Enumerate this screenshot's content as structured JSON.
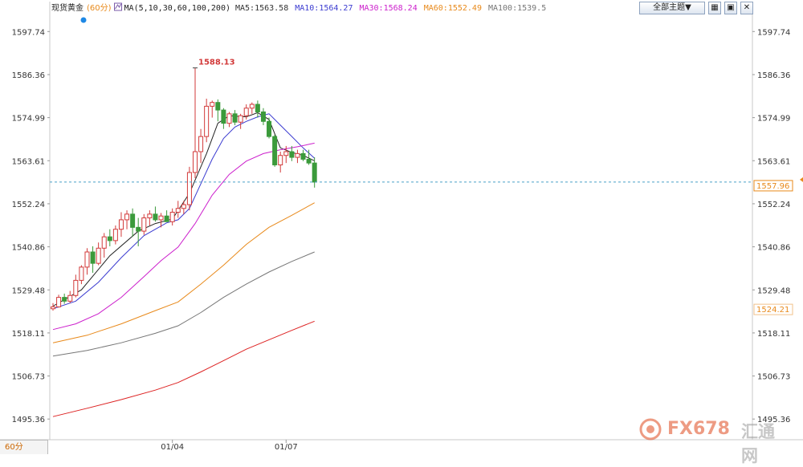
{
  "header": {
    "instrument": "现货黄金",
    "timeframe": "(60分)",
    "ma_label": "MA(5,10,30,60,100,200)",
    "ma_values": [
      {
        "text": "MA5:1563.58",
        "color": "#333333"
      },
      {
        "text": "MA10:1564.27",
        "color": "#3b3bd0"
      },
      {
        "text": "MA30:1568.24",
        "color": "#cc1fcc"
      },
      {
        "text": "MA60:1552.49",
        "color": "#e8891a"
      },
      {
        "text": "MA100:1539.5",
        "color": "#777777"
      }
    ]
  },
  "toolbar": {
    "theme_label": "全部主题▼"
  },
  "footer": {
    "timeframe_tab": "60分"
  },
  "watermark": {
    "text": "FX678",
    "cn": "汇通网"
  },
  "chart_data": {
    "type": "candlestick",
    "yticks": [
      "1597.74",
      "1586.36",
      "1574.99",
      "1563.61",
      "1552.24",
      "1540.86",
      "1529.48",
      "1518.11",
      "1506.73",
      "1495.36"
    ],
    "ylim": [
      1490,
      1600
    ],
    "xticks": [
      {
        "label": "01/04",
        "index": 21
      },
      {
        "label": "01/07",
        "index": 41
      }
    ],
    "last_price": "1557.96",
    "right_label": "1524.21",
    "high_annotation": {
      "text": "1588.13",
      "index": 25
    },
    "candles": [
      [
        1524.5,
        1526.0,
        1524.0,
        1525.0
      ],
      [
        1525.0,
        1528.2,
        1524.8,
        1527.5
      ],
      [
        1527.5,
        1528.5,
        1525.8,
        1526.5
      ],
      [
        1526.5,
        1529.2,
        1526.0,
        1528.0
      ],
      [
        1528.0,
        1533.5,
        1527.5,
        1532.0
      ],
      [
        1532.0,
        1536.0,
        1531.0,
        1535.5
      ],
      [
        1535.5,
        1540.5,
        1533.5,
        1539.5
      ],
      [
        1539.5,
        1541.0,
        1534.0,
        1536.5
      ],
      [
        1536.5,
        1542.0,
        1536.0,
        1540.5
      ],
      [
        1540.5,
        1544.5,
        1538.0,
        1543.5
      ],
      [
        1543.5,
        1545.5,
        1541.0,
        1542.5
      ],
      [
        1542.5,
        1546.5,
        1541.5,
        1545.5
      ],
      [
        1545.5,
        1550.0,
        1543.5,
        1548.0
      ],
      [
        1548.0,
        1550.5,
        1545.5,
        1549.5
      ],
      [
        1549.5,
        1551.0,
        1543.5,
        1546.0
      ],
      [
        1546.0,
        1548.5,
        1541.0,
        1545.0
      ],
      [
        1545.0,
        1549.5,
        1544.0,
        1548.5
      ],
      [
        1548.5,
        1550.5,
        1546.5,
        1549.5
      ],
      [
        1549.5,
        1551.5,
        1547.5,
        1548.0
      ],
      [
        1548.0,
        1549.8,
        1546.0,
        1549.0
      ],
      [
        1549.0,
        1550.5,
        1547.5,
        1547.5
      ],
      [
        1547.5,
        1551.0,
        1546.5,
        1550.0
      ],
      [
        1550.0,
        1553.0,
        1548.5,
        1551.0
      ],
      [
        1551.0,
        1553.0,
        1549.5,
        1552.0
      ],
      [
        1552.0,
        1562.0,
        1550.5,
        1560.5
      ],
      [
        1560.5,
        1588.13,
        1559.0,
        1566.0
      ],
      [
        1566.0,
        1572.0,
        1563.0,
        1570.0
      ],
      [
        1570.0,
        1580.0,
        1568.5,
        1578.0
      ],
      [
        1578.0,
        1579.5,
        1575.0,
        1579.0
      ],
      [
        1579.0,
        1579.8,
        1574.0,
        1577.0
      ],
      [
        1577.0,
        1577.5,
        1572.0,
        1573.5
      ],
      [
        1573.5,
        1576.5,
        1572.5,
        1576.0
      ],
      [
        1576.0,
        1577.0,
        1573.0,
        1573.8
      ],
      [
        1573.8,
        1576.0,
        1572.0,
        1575.5
      ],
      [
        1575.5,
        1578.5,
        1574.5,
        1577.5
      ],
      [
        1577.5,
        1579.0,
        1576.0,
        1578.5
      ],
      [
        1578.5,
        1579.5,
        1575.0,
        1576.5
      ],
      [
        1576.5,
        1577.5,
        1573.0,
        1574.0
      ],
      [
        1574.0,
        1575.0,
        1569.5,
        1570.0
      ],
      [
        1570.0,
        1570.5,
        1562.0,
        1562.5
      ],
      [
        1562.5,
        1566.0,
        1560.5,
        1565.0
      ],
      [
        1565.0,
        1567.5,
        1563.0,
        1566.0
      ],
      [
        1566.0,
        1567.5,
        1563.5,
        1564.5
      ],
      [
        1564.5,
        1566.5,
        1563.0,
        1565.5
      ],
      [
        1565.5,
        1566.5,
        1563.5,
        1564.0
      ],
      [
        1564.0,
        1566.5,
        1562.5,
        1563.0
      ],
      [
        1563.0,
        1564.5,
        1556.5,
        1557.96
      ]
    ],
    "series": [
      {
        "name": "MA5",
        "color": "#222222",
        "values": [
          [
            0,
            1525.2
          ],
          [
            5,
            1529.5
          ],
          [
            10,
            1538.5
          ],
          [
            15,
            1545.0
          ],
          [
            18,
            1547.0
          ],
          [
            21,
            1548.2
          ],
          [
            24,
            1555.0
          ],
          [
            27,
            1565.5
          ],
          [
            29,
            1573.5
          ],
          [
            31,
            1575.5
          ],
          [
            34,
            1575.2
          ],
          [
            36,
            1576.3
          ],
          [
            38,
            1574.5
          ],
          [
            40,
            1567.0
          ],
          [
            42,
            1565.8
          ],
          [
            44,
            1565.0
          ],
          [
            46,
            1563.58
          ]
        ]
      },
      {
        "name": "MA10",
        "color": "#3b3bd0",
        "values": [
          [
            0,
            1524.5
          ],
          [
            4,
            1526.5
          ],
          [
            8,
            1531.5
          ],
          [
            12,
            1538.0
          ],
          [
            16,
            1543.8
          ],
          [
            20,
            1547.2
          ],
          [
            22,
            1548.0
          ],
          [
            24,
            1551.0
          ],
          [
            26,
            1557.5
          ],
          [
            28,
            1564.0
          ],
          [
            30,
            1569.5
          ],
          [
            32,
            1572.5
          ],
          [
            34,
            1574.0
          ],
          [
            36,
            1575.2
          ],
          [
            38,
            1576.0
          ],
          [
            40,
            1573.0
          ],
          [
            42,
            1570.0
          ],
          [
            44,
            1567.0
          ],
          [
            46,
            1564.27
          ]
        ]
      },
      {
        "name": "MA30",
        "color": "#cc1fcc",
        "values": [
          [
            0,
            1519.0
          ],
          [
            4,
            1520.5
          ],
          [
            8,
            1523.2
          ],
          [
            12,
            1527.5
          ],
          [
            16,
            1533.0
          ],
          [
            19,
            1537.2
          ],
          [
            22,
            1540.8
          ],
          [
            25,
            1547.0
          ],
          [
            28,
            1554.5
          ],
          [
            31,
            1560.0
          ],
          [
            34,
            1563.5
          ],
          [
            37,
            1565.5
          ],
          [
            40,
            1566.5
          ],
          [
            43,
            1567.3
          ],
          [
            46,
            1568.24
          ]
        ]
      },
      {
        "name": "MA60",
        "color": "#e8891a",
        "values": [
          [
            0,
            1515.5
          ],
          [
            6,
            1517.5
          ],
          [
            12,
            1520.5
          ],
          [
            18,
            1524.0
          ],
          [
            22,
            1526.3
          ],
          [
            26,
            1531.0
          ],
          [
            30,
            1536.0
          ],
          [
            34,
            1541.5
          ],
          [
            38,
            1546.0
          ],
          [
            42,
            1549.2
          ],
          [
            46,
            1552.49
          ]
        ]
      },
      {
        "name": "MA100",
        "color": "#777777",
        "values": [
          [
            0,
            1512.0
          ],
          [
            6,
            1513.5
          ],
          [
            12,
            1515.5
          ],
          [
            18,
            1518.0
          ],
          [
            22,
            1520.0
          ],
          [
            26,
            1523.5
          ],
          [
            30,
            1527.5
          ],
          [
            34,
            1531.0
          ],
          [
            38,
            1534.2
          ],
          [
            42,
            1537.0
          ],
          [
            46,
            1539.5
          ]
        ]
      },
      {
        "name": "MA200",
        "color": "#dd2222",
        "values": [
          [
            0,
            1496.0
          ],
          [
            6,
            1498.2
          ],
          [
            12,
            1500.5
          ],
          [
            18,
            1503.0
          ],
          [
            22,
            1505.0
          ],
          [
            26,
            1507.8
          ],
          [
            30,
            1510.8
          ],
          [
            34,
            1513.8
          ],
          [
            38,
            1516.3
          ],
          [
            42,
            1518.8
          ],
          [
            46,
            1521.2
          ]
        ]
      }
    ]
  }
}
